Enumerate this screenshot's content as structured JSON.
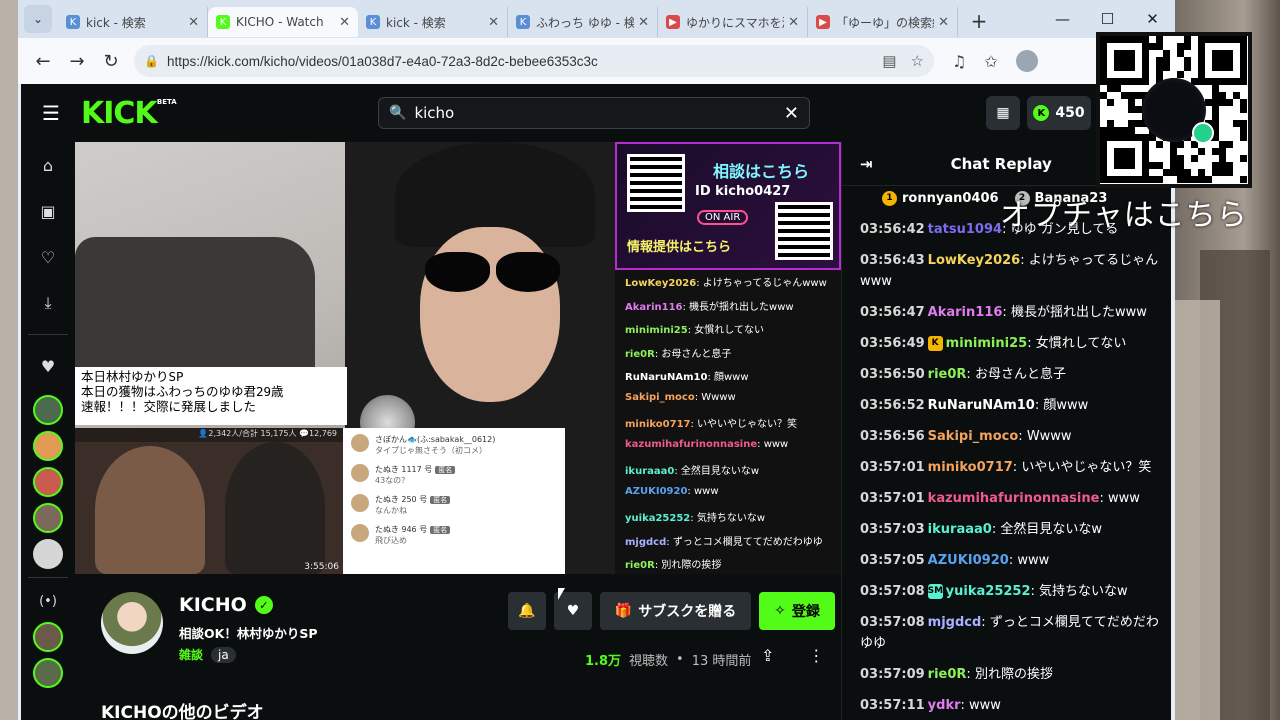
{
  "browser": {
    "tabs": [
      {
        "label": "kick - 検索",
        "color": "#5a8fd6",
        "icon": "K"
      },
      {
        "label": "KICHO - Watch",
        "color": "#53fc18",
        "icon": "K",
        "active": true
      },
      {
        "label": "kick - 検索",
        "color": "#5a8fd6",
        "icon": "K"
      },
      {
        "label": "ふわっち ゆゆ - 検索",
        "color": "#5a8fd6",
        "icon": "K"
      },
      {
        "label": "ゆかりにスマホを渡す",
        "color": "#d94a4a",
        "icon": "▶"
      },
      {
        "label": "「ゆーゆ」の検索結果",
        "color": "#d94a4a",
        "icon": "▶"
      }
    ],
    "url": "https://kick.com/kicho/videos/01a038d7-e4a0-72a3-8d2c-bebee6353c3c"
  },
  "header": {
    "logo": "KICK",
    "logo_tag": "BETA",
    "search_value": "kicho",
    "kicks": "450"
  },
  "overlay": {
    "title1": "相談はこちら",
    "title2": "ID kicho0427",
    "onair": "ON AIR",
    "title3": "情報提供はこちら",
    "chat": [
      {
        "user": "LowKey2026",
        "color": "#f4d35e",
        "text": "よけちゃってるじゃんwww"
      },
      {
        "user": "Akarin116",
        "color": "#e07cf0",
        "text": "機長が揺れ出したwww"
      },
      {
        "user": "minimini25",
        "color": "#8cf05a",
        "text": "女慣れしてない"
      },
      {
        "user": "rie0R",
        "color": "#8cf05a",
        "text": "お母さんと息子"
      },
      {
        "user": "RuNaruNAm10",
        "color": "#ffffff",
        "text": "顔www"
      },
      {
        "user": "Sakipi_moco",
        "color": "#f4a35e",
        "text": "Wwww"
      },
      {
        "user": "miniko0717",
        "color": "#f4a35e",
        "text": "いやいやじゃない？笑"
      },
      {
        "user": "kazumihafurinonnasine",
        "color": "#f05a8c",
        "text": "www"
      },
      {
        "user": "ikuraaa0",
        "color": "#5af0d2",
        "text": "全然目見ないなw"
      },
      {
        "user": "AZUKI0920",
        "color": "#5aa2f0",
        "text": "www"
      },
      {
        "user": "yuika25252",
        "color": "#5af0d2",
        "text": "気持ちないなw"
      },
      {
        "user": "mjgdcd",
        "color": "#a7b1ff",
        "text": "ずっとコメ欄見ててだめだわゆゆ"
      },
      {
        "user": "rie0R",
        "color": "#8cf05a",
        "text": "別れ際の挨拶"
      }
    ]
  },
  "video": {
    "caption": [
      "本日林村ゆかりSP",
      "本日の獲物はふわっちのゆゆ君29歳",
      "速報！！！交際に発展しました"
    ],
    "pip_stats": "👤2,342人/合計 15,175人  💬12,769",
    "pip_duration": "3:55:06",
    "comments": [
      {
        "user": "さぼかん🐟(ふ:sabakak__0612)",
        "text": "タイプじゃ無さそう（初コメ）",
        "badge": ""
      },
      {
        "user": "たぬき 1117 号",
        "text": "43なの？",
        "badge": "匿名"
      },
      {
        "user": "たぬき 250 号",
        "text": "なんかね",
        "badge": "匿名"
      },
      {
        "user": "たぬき 946 号",
        "text": "飛び込め",
        "badge": "匿名"
      }
    ]
  },
  "channel": {
    "name": "KICHO",
    "title": "相談OK！林村ゆかりSP",
    "category": "雑談",
    "language": "ja",
    "gift_label": "サブスクを贈る",
    "follow_label": "登録",
    "views": "1.8万",
    "views_label": "視聴数",
    "ago": "13 時間前",
    "more_videos": "KICHOの他のビデオ"
  },
  "chat": {
    "title": "Chat Replay",
    "leaders": [
      {
        "rank": "1",
        "name": "ronnyan0406",
        "color": "#f5b400"
      },
      {
        "rank": "2",
        "name": "Banana23",
        "color": "#bbbbbb"
      }
    ],
    "messages": [
      {
        "ts": "03:56:42",
        "user": "tatsu1094",
        "color": "#7b6cf0",
        "text": "ゆゆ ガン見してる",
        "badge": ""
      },
      {
        "ts": "03:56:43",
        "user": "LowKey2026",
        "color": "#f4d35e",
        "text": "よけちゃってるじゃんwww",
        "badge": ""
      },
      {
        "ts": "03:56:47",
        "user": "Akarin116",
        "color": "#e07cf0",
        "text": "機長が揺れ出したwww",
        "badge": ""
      },
      {
        "ts": "03:56:49",
        "user": "minimini25",
        "color": "#8cf05a",
        "text": "女慣れしてない",
        "badge": "K"
      },
      {
        "ts": "03:56:50",
        "user": "rie0R",
        "color": "#8cf05a",
        "text": "お母さんと息子",
        "badge": ""
      },
      {
        "ts": "03:56:52",
        "user": "RuNaruNAm10",
        "color": "#ffffff",
        "text": "顔www",
        "badge": ""
      },
      {
        "ts": "03:56:56",
        "user": "Sakipi_moco",
        "color": "#f4a35e",
        "text": "Wwww",
        "badge": ""
      },
      {
        "ts": "03:57:01",
        "user": "miniko0717",
        "color": "#f4a35e",
        "text": "いやいやじゃない？笑",
        "badge": ""
      },
      {
        "ts": "03:57:01",
        "user": "kazumihafurinonnasine",
        "color": "#f05a8c",
        "text": "www",
        "badge": ""
      },
      {
        "ts": "03:57:03",
        "user": "ikuraaa0",
        "color": "#5af0d2",
        "text": "全然目見ないなw",
        "badge": ""
      },
      {
        "ts": "03:57:05",
        "user": "AZUKI0920",
        "color": "#5aa2f0",
        "text": "www",
        "badge": ""
      },
      {
        "ts": "03:57:08",
        "user": "yuika25252",
        "color": "#5af0d2",
        "text": "気持ちないなw",
        "badge": "SM"
      },
      {
        "ts": "03:57:08",
        "user": "mjgdcd",
        "color": "#a7b1ff",
        "text": "ずっとコメ欄見ててだめだわゆゆ",
        "badge": ""
      },
      {
        "ts": "03:57:09",
        "user": "rie0R",
        "color": "#8cf05a",
        "text": "別れ際の挨拶",
        "badge": ""
      },
      {
        "ts": "03:57:11",
        "user": "ydkr",
        "color": "#e07cf0",
        "text": "www",
        "badge": ""
      }
    ]
  },
  "stream_overlay": {
    "text": "オプチャはこちら"
  }
}
